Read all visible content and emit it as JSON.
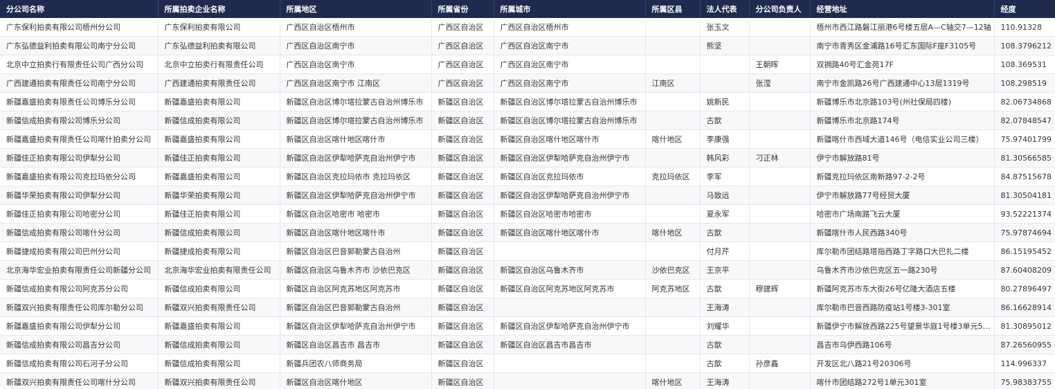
{
  "table": {
    "columns": [
      "分公司名称",
      "所属拍卖企业名称",
      "所属地区",
      "所属省份",
      "所属城市",
      "所属区县",
      "法人代表",
      "分公司负责人",
      "经营地址",
      "经度"
    ],
    "rows": [
      [
        "广东保利拍卖有限公司梧州分公司",
        "广东保利拍卖有限公司",
        "广西区自治区梧州市",
        "广西区自治区",
        "广西区自治区梧州市",
        "",
        "张玉文",
        "",
        "梧州市西江路磐江丽港6号楼五层A—C轴交7—12轴",
        "110.91328"
      ],
      [
        "广东弘德益利拍卖有限公司南宁分公司",
        "广东弘德益利拍卖有限公司",
        "广西区自治区南宁市",
        "广西区自治区",
        "广西区自治区南宁市",
        "",
        "熊坚",
        "",
        "南宁市青秀区金浦路16号汇东国际F座F3105号",
        "108.3796212"
      ],
      [
        "北京中立拍卖行有限责任公司广西分公司",
        "北京中立拍卖行有限责任公司",
        "广西区自治区南宁市",
        "广西区自治区",
        "广西区自治区南宁市",
        "",
        "",
        "王朝晖",
        "双拥路40号汇金苑17F",
        "108.369531"
      ],
      [
        "广西建通拍卖有限责任公司南宁分公司",
        "广西建通拍卖有限责任公司",
        "广西区自治区南宁市 江南区",
        "广西区自治区",
        "广西区自治区南宁市",
        "江南区",
        "",
        "张滢",
        "南宁市金凯路26号广西建通中心13层1319号",
        "108.298519"
      ],
      [
        "新疆嘉盛拍卖有限责任公司博乐分公司",
        "新疆嘉盛拍卖有限公司",
        "新疆区自治区博尔塔拉蒙古自治州博乐市",
        "新疆区自治区",
        "新疆区自治区博尔塔拉蒙古自治州博乐市",
        "",
        "姚新民",
        "",
        "新疆博乐市北京路103号(州社保局四楼)",
        "82.06734868"
      ],
      [
        "新疆信成拍卖有限公司博乐分公司",
        "新疆信成拍卖有限公司",
        "新疆区自治区博尔塔拉蒙古自治州博乐市",
        "新疆区自治区",
        "新疆区自治区博尔塔拉蒙古自治州博乐市",
        "",
        "古歆",
        "",
        "新疆博乐市北京路174号",
        "82.07848547"
      ],
      [
        "新疆嘉盛拍卖有限责任公司喀什拍卖分公司",
        "新疆嘉盛拍卖有限公司",
        "新疆区自治区喀什地区喀什市",
        "新疆区自治区",
        "新疆区自治区喀什地区喀什市",
        "喀什地区",
        "李康强",
        "",
        "新疆喀什市西域大道146号（电信实业公司三楼）",
        "75.97401799"
      ],
      [
        "新疆佳正拍卖有限公司伊犁分公司",
        "新疆佳正拍卖有限公司",
        "新疆区自治区伊犁哈萨克自治州伊宁市",
        "新疆区自治区",
        "新疆区自治区伊犁哈萨克自治州伊宁市",
        "",
        "韩风彩",
        "刁正林",
        "伊宁市解放路81号",
        "81.30566585"
      ],
      [
        "新疆嘉盛拍卖有限公司克拉玛依分公司",
        "新疆嘉盛拍卖有限公司",
        "新疆区自治区克拉玛依市 克拉玛依区",
        "新疆区自治区",
        "新疆区自治区克拉玛依市",
        "克拉玛依区",
        "李军",
        "",
        "新疆克拉玛依区南新路97-2-2号",
        "84.87515678"
      ],
      [
        "新疆华荣拍卖有限公司伊犁分公司",
        "新疆华荣拍卖有限公司",
        "新疆区自治区伊犁哈萨克自治州伊宁市",
        "新疆区自治区",
        "新疆区自治区伊犁哈萨克自治州伊宁市",
        "",
        "马致远",
        "",
        "伊宁市解放路77号经贸大厦",
        "81.30504181"
      ],
      [
        "新疆佳正拍卖有限公司哈密分公司",
        "新疆佳正拍卖有限公司",
        "新疆区自治区哈密市 哈密市",
        "新疆区自治区",
        "新疆区自治区哈密市哈密市",
        "",
        "夏永军",
        "",
        "哈密市广场南路飞云大厦",
        "93.52221374"
      ],
      [
        "新疆信成拍卖有限公司喀什分公司",
        "新疆信成拍卖有限公司",
        "新疆区自治区喀什地区喀什市",
        "新疆区自治区",
        "新疆区自治区喀什地区喀什市",
        "喀什地区",
        "古歆",
        "",
        "新疆喀什市人民西路340号",
        "75.97874694"
      ],
      [
        "新疆捷成拍卖有限公司巴州分公司",
        "新疆捷成拍卖有限公司",
        "新疆区自治区巴音郭勒蒙古自治州",
        "新疆区自治区",
        "",
        "",
        "付月芹",
        "",
        "库尔勒市团结路塔指西路丁字路口大巴扎二楼",
        "86.15195452"
      ],
      [
        "北京海华宏业拍卖有限责任公司新疆分公司",
        "北京海华宏业拍卖有限责任公司",
        "新疆区自治区乌鲁木齐市 沙依巴克区",
        "新疆区自治区",
        "新疆区自治区乌鲁木齐市",
        "沙依巴克区",
        "王京平",
        "",
        "乌鲁木齐市沙依巴克区五一路230号",
        "87.60408209"
      ],
      [
        "新疆信成拍卖有限公司阿克苏分公司",
        "新疆信成拍卖有限公司",
        "新疆区自治区阿克苏地区阿克苏市",
        "新疆区自治区",
        "新疆区自治区阿克苏地区阿克苏市",
        "阿克苏地区",
        "古歆",
        "穆建辉",
        "新疆阿克苏市东大街26号亿隆大酒店五楼",
        "80.27896497"
      ],
      [
        "新疆双兴拍卖有限责任公司库尔勒分公司",
        "新疆双兴拍卖有限责任公司",
        "新疆区自治区巴音郭勒蒙古自治州",
        "新疆区自治区",
        "",
        "",
        "王海涛",
        "",
        "库尔勒市巴音西路防疫站1号楼3-301室",
        "86.16628914"
      ],
      [
        "新疆嘉盛拍卖有限公司伊犁分公司",
        "新疆嘉盛拍卖有限公司",
        "新疆区自治区伊犁哈萨克自治州伊宁市",
        "新疆区自治区",
        "新疆区自治区伊犁哈萨克自治州伊宁市",
        "",
        "刘耀华",
        "",
        "新疆伊宁市解放西路225号望景华庭1号楼3单元50...",
        "81.30895012"
      ],
      [
        "新疆信成拍卖有限公司昌吉分公司",
        "新疆信成拍卖有限公司",
        "新疆区自治区昌吉市 昌吉市",
        "新疆区自治区",
        "新疆区自治区昌吉市昌吉市",
        "",
        "古歆",
        "",
        "昌吉市乌伊西路106号",
        "87.26560955"
      ],
      [
        "新疆信成拍卖有限公司石河子分公司",
        "新疆信成拍卖有限公司",
        "新疆兵团农八师商务局",
        "新疆区自治区",
        "",
        "",
        "古歆",
        "孙彦鑫",
        "开发区北八路21号20306号",
        "114.996337"
      ],
      [
        "新疆双兴拍卖有限责任公司喀什分公司",
        "新疆双兴拍卖有限责任公司",
        "新疆区自治区喀什地区",
        "新疆区自治区",
        "",
        "喀什地区",
        "王海涛",
        "",
        "喀什市团结路272号1单元301室",
        "75.98383755"
      ]
    ]
  }
}
